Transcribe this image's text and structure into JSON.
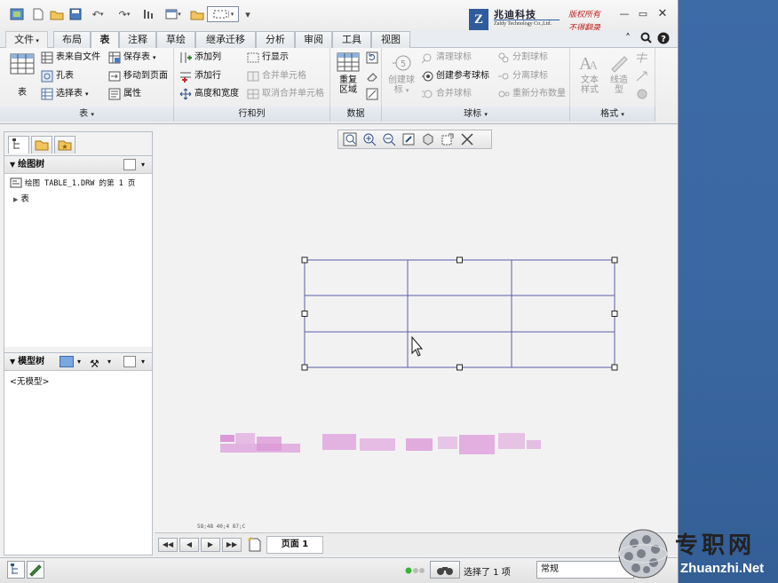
{
  "app": {
    "brand": {
      "logo": "Z",
      "name_cn": "兆迪科技",
      "name_en": "Zaldy Technology Co.,Ltd.",
      "slogan1": "版权所有",
      "slogan2": "不得翻录"
    }
  },
  "menu": {
    "file": "文件",
    "tabs": [
      "布局",
      "表",
      "注释",
      "草绘",
      "继承迁移",
      "分析",
      "审阅",
      "工具",
      "视图"
    ]
  },
  "ribbon": {
    "table_group": {
      "label": "表",
      "big_table": "表",
      "table_from_file": "表来自文件",
      "hole_table": "孔表",
      "select_table": "选择表",
      "save_table": "保存表",
      "move_to_page": "移动到页面",
      "properties": "属性"
    },
    "rowcol_group": {
      "label": "行和列",
      "add_column": "添加列",
      "add_row": "添加行",
      "height_width": "高度和宽度",
      "row_display": "行显示",
      "merge_cells": "合并单元格",
      "unmerge_cells": "取消合并单元格"
    },
    "data_group": {
      "label": "数据",
      "repeat_region_1": "重复",
      "repeat_region_2": "区域"
    },
    "balloon_group": {
      "label": "球标",
      "create_balloon_1": "创建球",
      "create_balloon_2": "标",
      "balloon_number": "5",
      "clean_balloons": "清理球标",
      "create_ref_balloon": "创建参考球标",
      "merge_balloons": "合并球标",
      "split_balloon": "分割球标",
      "separate_balloon": "分离球标",
      "redistribute_qty": "重新分布数量"
    },
    "format_group": {
      "label": "格式",
      "text_style_1": "文本",
      "text_style_2": "样式",
      "line_style_1": "线造",
      "line_style_2": "型"
    }
  },
  "left_panel": {
    "drawing_tree": {
      "title": "绘图树",
      "root": "绘图 TABLE_1.DRW 的第 1 页",
      "child": "表"
    },
    "model_tree": {
      "title": "模型树",
      "empty": "<无模型>"
    }
  },
  "canvas": {
    "coords": "58;48  40;4  87;C",
    "table": {
      "rows": 3,
      "columns": 3
    }
  },
  "pagebar": {
    "page_label": "页面 1"
  },
  "statusbar": {
    "selection": "选择了 1 项",
    "filter": "常规"
  },
  "watermark": {
    "cn": "专职网",
    "url": "Zhuanzhi.Net"
  }
}
